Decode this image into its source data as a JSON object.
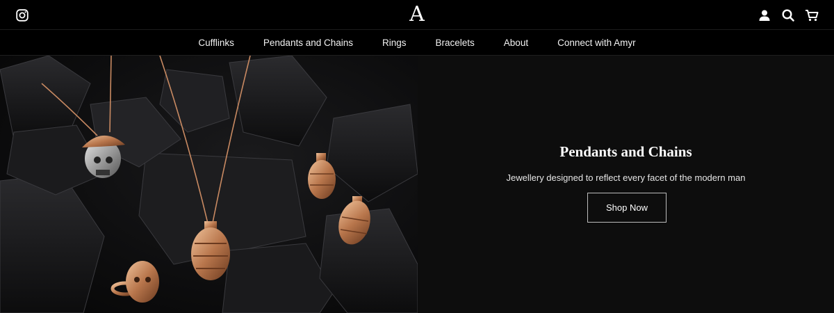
{
  "header": {
    "logo_text": "A",
    "icons": [
      "instagram-icon",
      "account-icon",
      "search-icon",
      "cart-icon"
    ]
  },
  "nav": {
    "items": [
      {
        "label": "Cufflinks"
      },
      {
        "label": "Pendants and Chains"
      },
      {
        "label": "Rings"
      },
      {
        "label": "Bracelets"
      },
      {
        "label": "About"
      },
      {
        "label": "Connect with Amyr"
      }
    ]
  },
  "hero": {
    "title": "Pendants and Chains",
    "subtitle": "Jewellery designed to reflect every facet of the modern man",
    "button_label": "Shop Now"
  },
  "colors": {
    "background": "#000000",
    "panel": "#0d0d0d",
    "accent_rose_gold": "#c98a62"
  }
}
